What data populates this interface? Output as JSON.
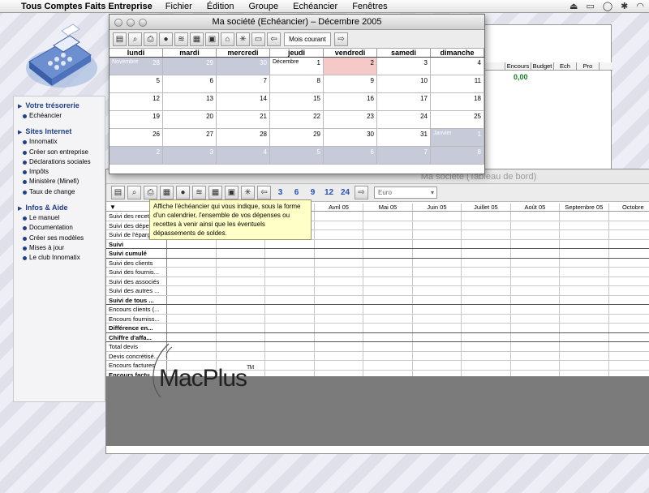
{
  "menubar": {
    "app": "Tous Comptes Faits Entreprise",
    "items": [
      "Fichier",
      "Édition",
      "Groupe",
      "Echéancier",
      "Fenêtres"
    ]
  },
  "sidebar": {
    "sections": [
      {
        "title": "Votre trésorerie",
        "items": [
          "Echéancier"
        ]
      },
      {
        "title": "Sites Internet",
        "items": [
          "Innomatix",
          "Créer son entreprise",
          "Déclarations sociales",
          "Impôts",
          "Ministère (Minefi)",
          "Taux de change"
        ]
      },
      {
        "title": "Infos & Aide",
        "items": [
          "Le manuel",
          "Documentation",
          "Créer ses modèles",
          "Mises à jour",
          "Le club Innomatix"
        ]
      }
    ]
  },
  "background_window": {
    "columns": [
      "Encours",
      "Budget",
      "Ech",
      "Pro"
    ],
    "value": "0,00"
  },
  "calendar": {
    "title": "Ma société (Echéancier) – Décembre 2005",
    "current_month_button": "Mois courant",
    "days": [
      "lundi",
      "mardi",
      "mercredi",
      "jeudi",
      "vendredi",
      "samedi",
      "dimanche"
    ],
    "weeks": [
      [
        {
          "d": "28",
          "o": true,
          "label": "Novembre"
        },
        {
          "d": "29",
          "o": true
        },
        {
          "d": "30",
          "o": true
        },
        {
          "d": "1",
          "label": "Décembre"
        },
        {
          "d": "2",
          "hl": true
        },
        {
          "d": "3"
        },
        {
          "d": "4"
        }
      ],
      [
        {
          "d": "5"
        },
        {
          "d": "6"
        },
        {
          "d": "7"
        },
        {
          "d": "8"
        },
        {
          "d": "9"
        },
        {
          "d": "10"
        },
        {
          "d": "11"
        }
      ],
      [
        {
          "d": "12"
        },
        {
          "d": "13"
        },
        {
          "d": "14"
        },
        {
          "d": "15"
        },
        {
          "d": "16"
        },
        {
          "d": "17"
        },
        {
          "d": "18"
        }
      ],
      [
        {
          "d": "19"
        },
        {
          "d": "20"
        },
        {
          "d": "21"
        },
        {
          "d": "22"
        },
        {
          "d": "23"
        },
        {
          "d": "24"
        },
        {
          "d": "25"
        }
      ],
      [
        {
          "d": "26"
        },
        {
          "d": "27"
        },
        {
          "d": "28"
        },
        {
          "d": "29"
        },
        {
          "d": "30"
        },
        {
          "d": "31"
        },
        {
          "d": "1",
          "o": true,
          "label": "Janvier"
        }
      ],
      [
        {
          "d": "2",
          "o": true
        },
        {
          "d": "3",
          "o": true
        },
        {
          "d": "4",
          "o": true
        },
        {
          "d": "5",
          "o": true
        },
        {
          "d": "6",
          "o": true
        },
        {
          "d": "7",
          "o": true
        },
        {
          "d": "8",
          "o": true
        }
      ]
    ]
  },
  "tableau": {
    "title": "Ma société (Tableau de bord)",
    "periods": [
      "3",
      "6",
      "9",
      "12",
      "24"
    ],
    "currency": "Euro",
    "months": [
      "",
      "",
      "",
      "Avril 05",
      "Mai 05",
      "Juin 05",
      "Juillet 05",
      "Août 05",
      "Septembre 05",
      "Octobre"
    ],
    "rows": [
      {
        "t": "Suivi des recettes",
        "b": false
      },
      {
        "t": "Suivi des dépenses",
        "b": false
      },
      {
        "t": "Suivi de l'épargne",
        "b": false
      },
      {
        "t": "Suivi",
        "b": true,
        "sep": true
      },
      {
        "t": "Suivi cumulé",
        "b": true,
        "sep": true
      },
      {
        "t": "Suivi des clients",
        "b": false
      },
      {
        "t": "Suivi des fournis...",
        "b": false
      },
      {
        "t": "Suivi des associés",
        "b": false
      },
      {
        "t": "Suivi des autres ...",
        "b": false
      },
      {
        "t": "Suivi de tous ...",
        "b": true,
        "sep": true
      },
      {
        "t": "Encours clients (...",
        "b": false
      },
      {
        "t": "Encours fourniss...",
        "b": false
      },
      {
        "t": "Différence en...",
        "b": true,
        "sep": true
      },
      {
        "t": "Chiffre d'affa...",
        "b": true,
        "sep": true
      },
      {
        "t": "Total devis",
        "b": false
      },
      {
        "t": "Devis concrétisé...",
        "b": false
      },
      {
        "t": "Encours factures",
        "b": false
      },
      {
        "t": "Encours factu...",
        "b": true
      }
    ]
  },
  "tooltip": "Affiche l'échéancier qui vous indique, sous la forme d'un calendrier, l'ensemble de vos dépenses ou recettes à venir ainsi que les éventuels dépassements de soldes.",
  "watermark": {
    "text": "MacPlus",
    "tm": "TM"
  }
}
